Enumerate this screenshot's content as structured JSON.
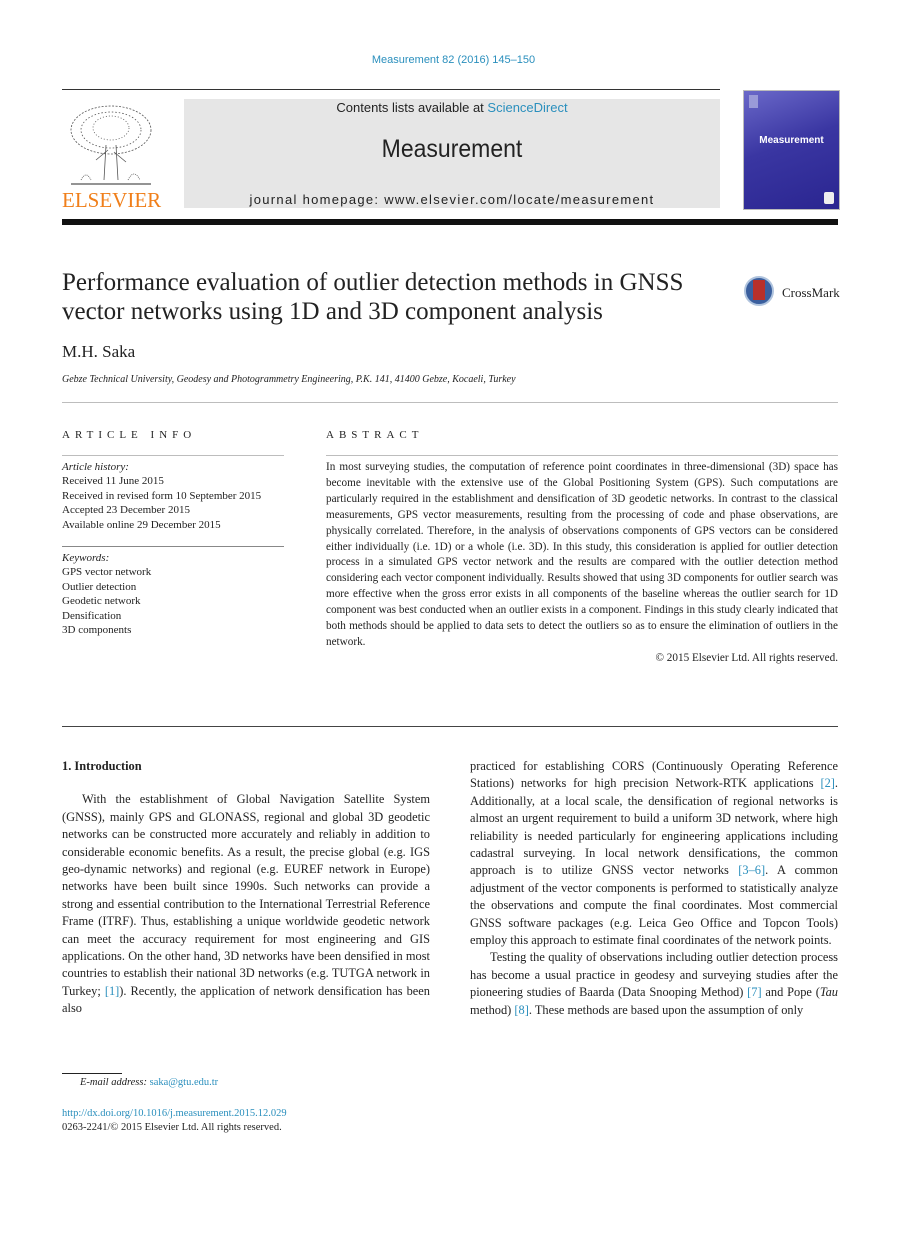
{
  "header": {
    "journal_ref": "Measurement 82 (2016) 145–150",
    "contents_prefix": "Contents lists available at ",
    "contents_link": "ScienceDirect",
    "journal_name": "Measurement",
    "homepage": "journal homepage: www.elsevier.com/locate/measurement",
    "publisher_logo": "ELSEVIER",
    "cover_title": "Measurement",
    "link_color": "#2a8fbd",
    "publisher_color": "#f07f1a"
  },
  "article": {
    "title": "Performance evaluation of outlier detection methods in GNSS vector networks using 1D and 3D component analysis",
    "crossmark_label": "CrossMark",
    "author": "M.H. Saka",
    "affiliation": "Gebze Technical University, Geodesy and Photogrammetry Engineering, P.K. 141, 41400 Gebze, Kocaeli, Turkey"
  },
  "article_info": {
    "heading": "ARTICLE INFO",
    "history_label": "Article history:",
    "history": [
      "Received 11 June 2015",
      "Received in revised form 10 September 2015",
      "Accepted 23 December 2015",
      "Available online 29 December 2015"
    ],
    "keywords_label": "Keywords:",
    "keywords": [
      "GPS vector network",
      "Outlier detection",
      "Geodetic network",
      "Densification",
      "3D components"
    ]
  },
  "abstract": {
    "heading": "ABSTRACT",
    "text": "In most surveying studies, the computation of reference point coordinates in three-dimensional (3D) space has become inevitable with the extensive use of the Global Positioning System (GPS). Such computations are particularly required in the establishment and densification of 3D geodetic networks. In contrast to the classical measurements, GPS vector measurements, resulting from the processing of code and phase observations, are physically correlated. Therefore, in the analysis of observations components of GPS vectors can be considered either individually (i.e. 1D) or a whole (i.e. 3D). In this study, this consideration is applied for outlier detection process in a simulated GPS vector network and the results are compared with the outlier detection method considering each vector component individually. Results showed that using 3D components for outlier search was more effective when the gross error exists in all components of the baseline whereas the outlier search for 1D component was best conducted when an outlier exists in a component. Findings in this study clearly indicated that both methods should be applied to data sets to detect the outliers so as to ensure the elimination of outliers in the network.",
    "copyright": "© 2015 Elsevier Ltd. All rights reserved."
  },
  "body": {
    "section_title": "1. Introduction",
    "left_p1": "With the establishment of Global Navigation Satellite System (GNSS), mainly GPS and GLONASS, regional and global 3D geodetic networks can be constructed more accurately and reliably in addition to considerable economic benefits. As a result, the precise global (e.g. IGS geo-dynamic networks) and regional (e.g. EUREF network in Europe) networks have been built since 1990s. Such networks can provide a strong and essential contribution to the International Terrestrial Reference Frame (ITRF). Thus, establishing a unique worldwide geodetic network can meet the accuracy requirement for most engineering and GIS applications. On the other hand, 3D networks have been densified in most countries to establish their national 3D networks (e.g. TUTGA network in Turkey; ",
    "ref1": "[1]",
    "left_p1_end": "). Recently, the application of network densification has been also",
    "right_p1_a": "practiced for establishing CORS (Continuously Operating Reference Stations) networks for high precision Network-RTK applications ",
    "ref2": "[2]",
    "right_p1_b": ". Additionally, at a local scale, the densification of regional networks is almost an urgent requirement to build a uniform 3D network, where high reliability is needed particularly for engineering applications including cadastral surveying. In local network densifications, the common approach is to utilize GNSS vector networks ",
    "ref3_6": "[3–6]",
    "right_p1_c": ". A common adjustment of the vector components is performed to statistically analyze the observations and compute the final coordinates. Most commercial GNSS software packages (e.g. Leica Geo Office and Topcon Tools) employ this approach to estimate final coordinates of the network points.",
    "right_p2_a": "Testing the quality of observations including outlier detection process has become a usual practice in geodesy and surveying studies after the pioneering studies of Baarda (Data Snooping Method) ",
    "ref7": "[7]",
    "right_p2_b": " and Pope (",
    "tau": "Tau",
    "right_p2_c": " method) ",
    "ref8": "[8]",
    "right_p2_d": ". These methods are based upon the assumption of only"
  },
  "footer": {
    "email_label": "E-mail address: ",
    "email": "saka@gtu.edu.tr",
    "doi": "http://dx.doi.org/10.1016/j.measurement.2015.12.029",
    "issn": "0263-2241/© 2015 Elsevier Ltd. All rights reserved."
  }
}
